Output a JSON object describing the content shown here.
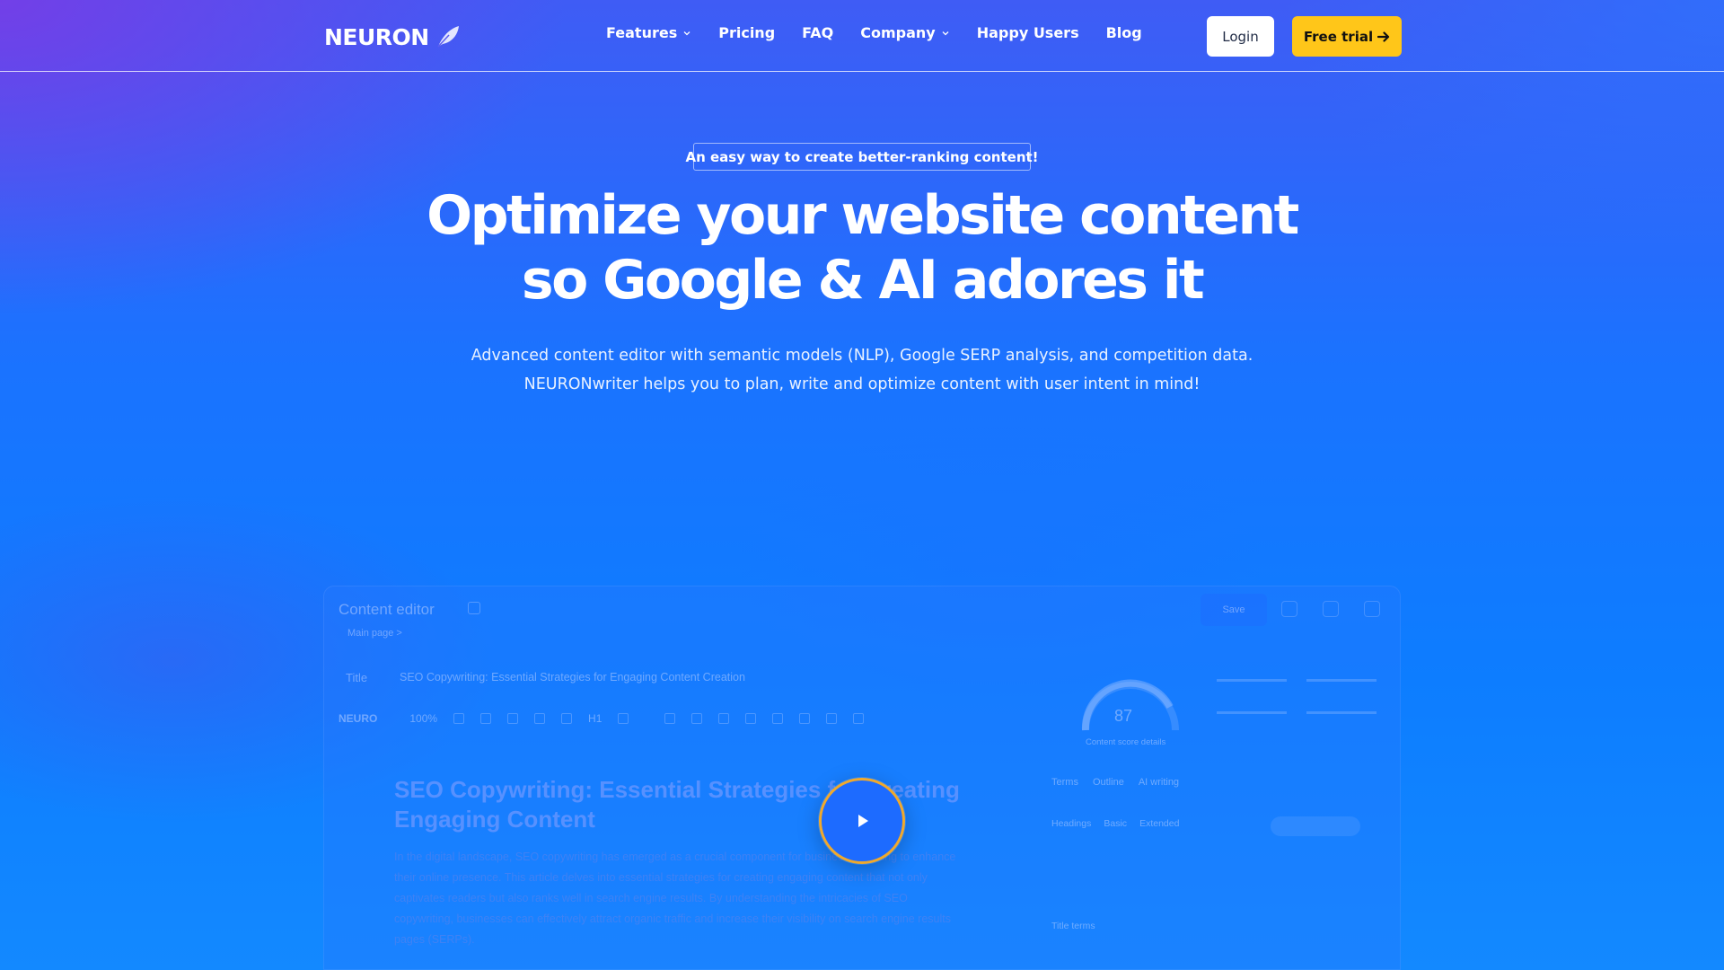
{
  "nav": {
    "logo_text": "NEURON",
    "links": [
      {
        "label": "Features",
        "has_dropdown": true
      },
      {
        "label": "Pricing",
        "has_dropdown": false
      },
      {
        "label": "FAQ",
        "has_dropdown": false
      },
      {
        "label": "Company",
        "has_dropdown": true
      },
      {
        "label": "Happy Users",
        "has_dropdown": false
      },
      {
        "label": "Blog",
        "has_dropdown": false
      }
    ],
    "login_label": "Login",
    "trial_label": "Free trial"
  },
  "hero": {
    "tagline": "An easy way to create better-ranking content!",
    "headline_line1": "Optimize your website content",
    "headline_line2": "so Google & AI adores it",
    "sub_line1": "Advanced content editor with semantic models (NLP), Google SERP analysis, and competition data.",
    "sub_line2": "NEURONwriter helps you to plan, write and optimize content with user intent in mind!"
  },
  "preview": {
    "window_title": "Content editor",
    "breadcrumb": "Main page >",
    "save_label": "Save",
    "title_label": "Title",
    "title_value": "SEO Copywriting: Essential Strategies for Engaging Content Creation",
    "toolbar_brand": "NEURO",
    "toolbar_zoom": "100%",
    "toolbar_style": "H1",
    "doc_heading": "SEO Copywriting: Essential Strategies for Creating Engaging Content",
    "doc_paragraph": "In the digital landscape, SEO copywriting has emerged as a crucial component for businesses aiming to enhance their online presence. This article delves into essential strategies for creating engaging content that not only captivates readers but also ranks well in search engine results. By understanding the intricacies of SEO copywriting, businesses can effectively attract organic traffic and increase their visibility on search engine results pages (SERPs).",
    "score": "87",
    "score_caption": "Content score details",
    "tabs": [
      "Terms",
      "Outline",
      "AI writing"
    ],
    "subtabs": [
      "Headings",
      "Basic",
      "Extended"
    ],
    "row_label": "Title terms"
  },
  "colors": {
    "accent_yellow": "#ffc619",
    "play_ring": "#f0a92c",
    "bg_blue": "#1a73ff",
    "bg_purple": "#7a3ce6"
  },
  "icons": [
    "feather-icon",
    "chevron-down-icon",
    "arrow-right-icon",
    "play-icon"
  ]
}
